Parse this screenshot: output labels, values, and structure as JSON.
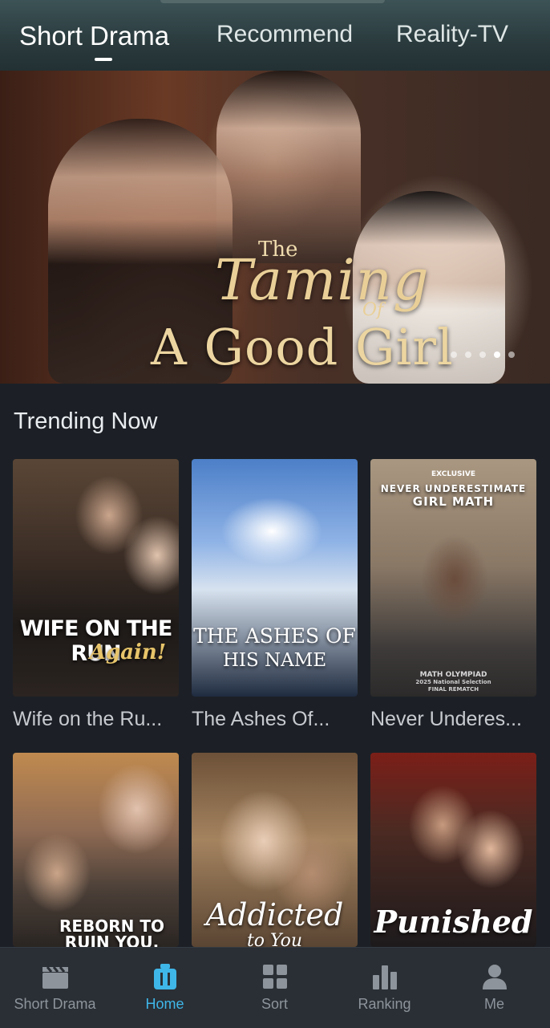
{
  "top_tabs": [
    {
      "label": "Short Drama",
      "active": true
    },
    {
      "label": "Recommend",
      "active": false
    },
    {
      "label": "Reality-TV",
      "active": false
    }
  ],
  "hero": {
    "title_the": "The",
    "title_taming": "Taming",
    "title_of": "Of",
    "title_main": "A Good Girl",
    "carousel_pages": 5,
    "carousel_active_index": 3
  },
  "trending": {
    "heading": "Trending Now",
    "items": [
      {
        "title": "Wife on the Ru...",
        "poster_text": "WIFE ON THE RUN",
        "poster_subtext": "Again!"
      },
      {
        "title": "The Ashes Of...",
        "poster_text": "THE ASHES OF",
        "poster_subtext": "HIS NAME"
      },
      {
        "title": "Never Underes...",
        "poster_badge": "EXCLUSIVE",
        "poster_text": "NEVER UNDERESTIMATE",
        "poster_subtext": "GIRL MATH",
        "poster_foot1": "MATH OLYMPIAD",
        "poster_foot2": "2025 National Selection",
        "poster_foot3": "FINAL REMATCH"
      },
      {
        "title": "",
        "poster_text": "REBORN TO",
        "poster_subtext": "RUIN YOU."
      },
      {
        "title": "",
        "poster_text": "Addicted",
        "poster_subtext": "to You"
      },
      {
        "title": "",
        "poster_text": "Punished",
        "poster_subtext": ""
      }
    ]
  },
  "bottom_nav": [
    {
      "label": "Short Drama",
      "icon": "clapperboard-icon",
      "active": false
    },
    {
      "label": "Home",
      "icon": "tv-icon",
      "active": true
    },
    {
      "label": "Sort",
      "icon": "grid-icon",
      "active": false
    },
    {
      "label": "Ranking",
      "icon": "bar-chart-icon",
      "active": false
    },
    {
      "label": "Me",
      "icon": "person-icon",
      "active": false
    }
  ],
  "colors": {
    "accent": "#3fb6e8",
    "background": "#1c2026",
    "nav_background": "#2a2f35"
  }
}
